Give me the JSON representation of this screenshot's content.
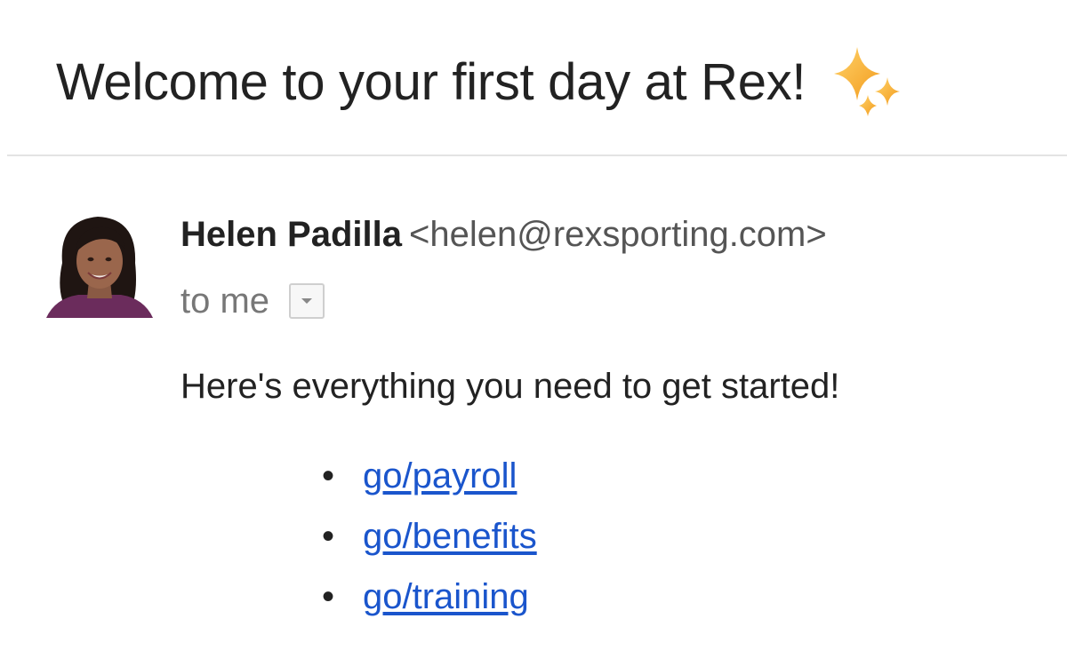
{
  "email": {
    "subject": "Welcome to your first day at Rex!",
    "subject_emoji": "sparkles-icon",
    "sender": {
      "name": "Helen Padilla",
      "email": "<helen@rexsporting.com>"
    },
    "recipient_text": "to me",
    "body_intro": "Here's everything you need to get started!",
    "links": [
      {
        "label": "go/payroll"
      },
      {
        "label": "go/benefits"
      },
      {
        "label": "go/training"
      }
    ]
  },
  "colors": {
    "link": "#1a55cc",
    "sparkle": "#f5b32b",
    "avatar_jacket": "#6b2c5c"
  }
}
